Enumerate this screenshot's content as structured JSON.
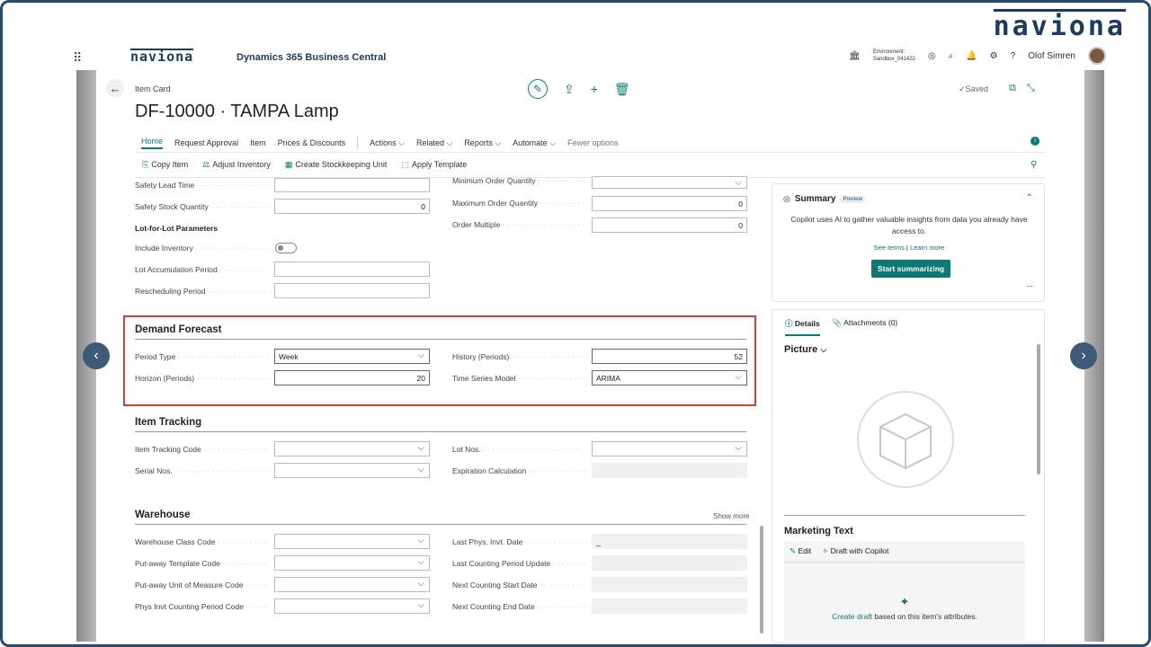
{
  "brand_top": "naviona",
  "topbar": {
    "logo": "naviona",
    "app_name": "Dynamics 365 Business Central",
    "env_label": "Environment:",
    "env_value": "Sandbox_041422",
    "user": "Olof Simren"
  },
  "page": {
    "breadcrumb": "Item Card",
    "title": "DF-10000 · TAMPA Lamp",
    "saved": "Saved"
  },
  "menu": {
    "home": "Home",
    "request_approval": "Request Approval",
    "item": "Item",
    "prices": "Prices & Discounts",
    "actions": "Actions",
    "related": "Related",
    "reports": "Reports",
    "automate": "Automate",
    "fewer": "Fewer options"
  },
  "action_bar": {
    "copy_item": "Copy Item",
    "adjust_inventory": "Adjust Inventory",
    "create_sku": "Create Stockkeeping Unit",
    "apply_template": "Apply Template"
  },
  "planning": {
    "safety_lead_time": "Safety Lead Time",
    "safety_stock_quantity": "Safety Stock Quantity",
    "safety_stock_value": "0",
    "lot_for_lot": "Lot-for-Lot Parameters",
    "include_inventory": "Include Inventory",
    "lot_accumulation_period": "Lot Accumulation Period",
    "rescheduling_period": "Rescheduling Period",
    "minimum_order_quantity": "Minimum Order Quantity",
    "maximum_order_quantity": "Maximum Order Quantity",
    "maximum_order_value": "0",
    "order_multiple": "Order Multiple",
    "order_multiple_value": "0"
  },
  "demand_forecast": {
    "title": "Demand Forecast",
    "period_type_label": "Period Type",
    "period_type_value": "Week",
    "horizon_label": "Horizon (Periods)",
    "horizon_value": "20",
    "history_label": "History (Periods)",
    "history_value": "52",
    "model_label": "Time Series Model",
    "model_value": "ARIMA"
  },
  "item_tracking": {
    "title": "Item Tracking",
    "tracking_code": "Item Tracking Code",
    "serial_nos": "Serial Nos.",
    "lot_nos": "Lot Nos.",
    "expiration": "Expiration Calculation"
  },
  "warehouse": {
    "title": "Warehouse",
    "show_more": "Show more",
    "class_code": "Warehouse Class Code",
    "putaway_template": "Put-away Template Code",
    "putaway_uom": "Put-away Unit of Measure Code",
    "phys_invt_period": "Phys Invt Counting Period Code",
    "last_phys_invt": "Last Phys. Invt. Date",
    "last_phys_invt_value": "_",
    "last_counting_update": "Last Counting Period Update",
    "next_counting_start": "Next Counting Start Date",
    "next_counting_end": "Next Counting End Date"
  },
  "summary": {
    "title": "Summary",
    "badge": "Preview",
    "text": "Copilot uses AI to gather valuable insights from data you already have access to.",
    "see_terms": "See terms",
    "learn_more": "Learn more",
    "button": "Start summarizing",
    "more": "..."
  },
  "details": {
    "tab_details": "Details",
    "tab_attachments": "Attachments (0)",
    "picture": "Picture",
    "marketing_text": "Marketing Text",
    "edit": "Edit",
    "draft_with_copilot": "Draft with Copilot",
    "create_draft_link": "Create draft",
    "create_draft_rest": " based on this item's attributes."
  }
}
